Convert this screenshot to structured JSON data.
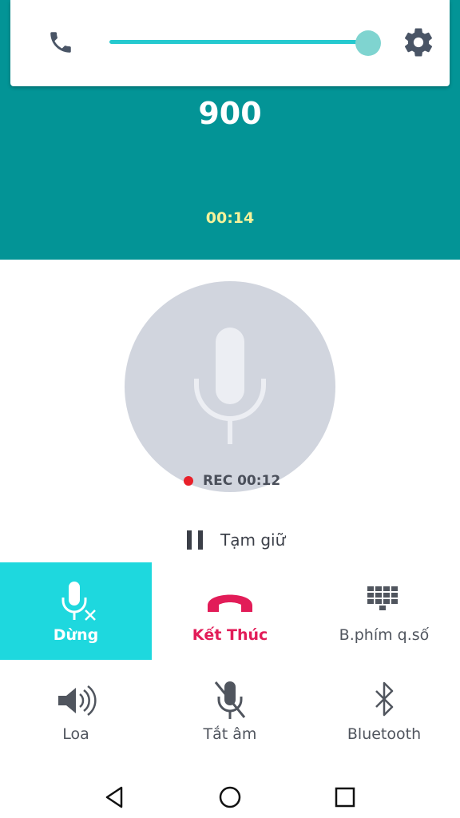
{
  "header": {
    "number": "900",
    "elapsed": "00:14",
    "colors": {
      "background": "#039496",
      "slider": "#25c9cf",
      "timer": "#f5f29a"
    },
    "volume_level": 1.0,
    "icons": {
      "left": "phone-icon",
      "right": "gear-icon"
    }
  },
  "recording": {
    "label": "REC 00:12",
    "icon": "microphone-icon",
    "dot_color": "#e8202a"
  },
  "hold": {
    "label": "Tạm giữ",
    "icon": "pause-icon"
  },
  "actions": [
    {
      "label": "Dừng",
      "icon": "microphone-stop-icon",
      "active": true
    },
    {
      "label": "Kết Thúc",
      "icon": "end-call-icon",
      "color": "#e21c58"
    },
    {
      "label": "B.phím q.số",
      "icon": "dialpad-icon"
    },
    {
      "label": "Loa",
      "icon": "speaker-icon"
    },
    {
      "label": "Tắt âm",
      "icon": "mute-icon"
    },
    {
      "label": "Bluetooth",
      "icon": "bluetooth-icon"
    }
  ],
  "navbar": {
    "icons": [
      "back-icon",
      "home-icon",
      "recents-icon"
    ]
  }
}
